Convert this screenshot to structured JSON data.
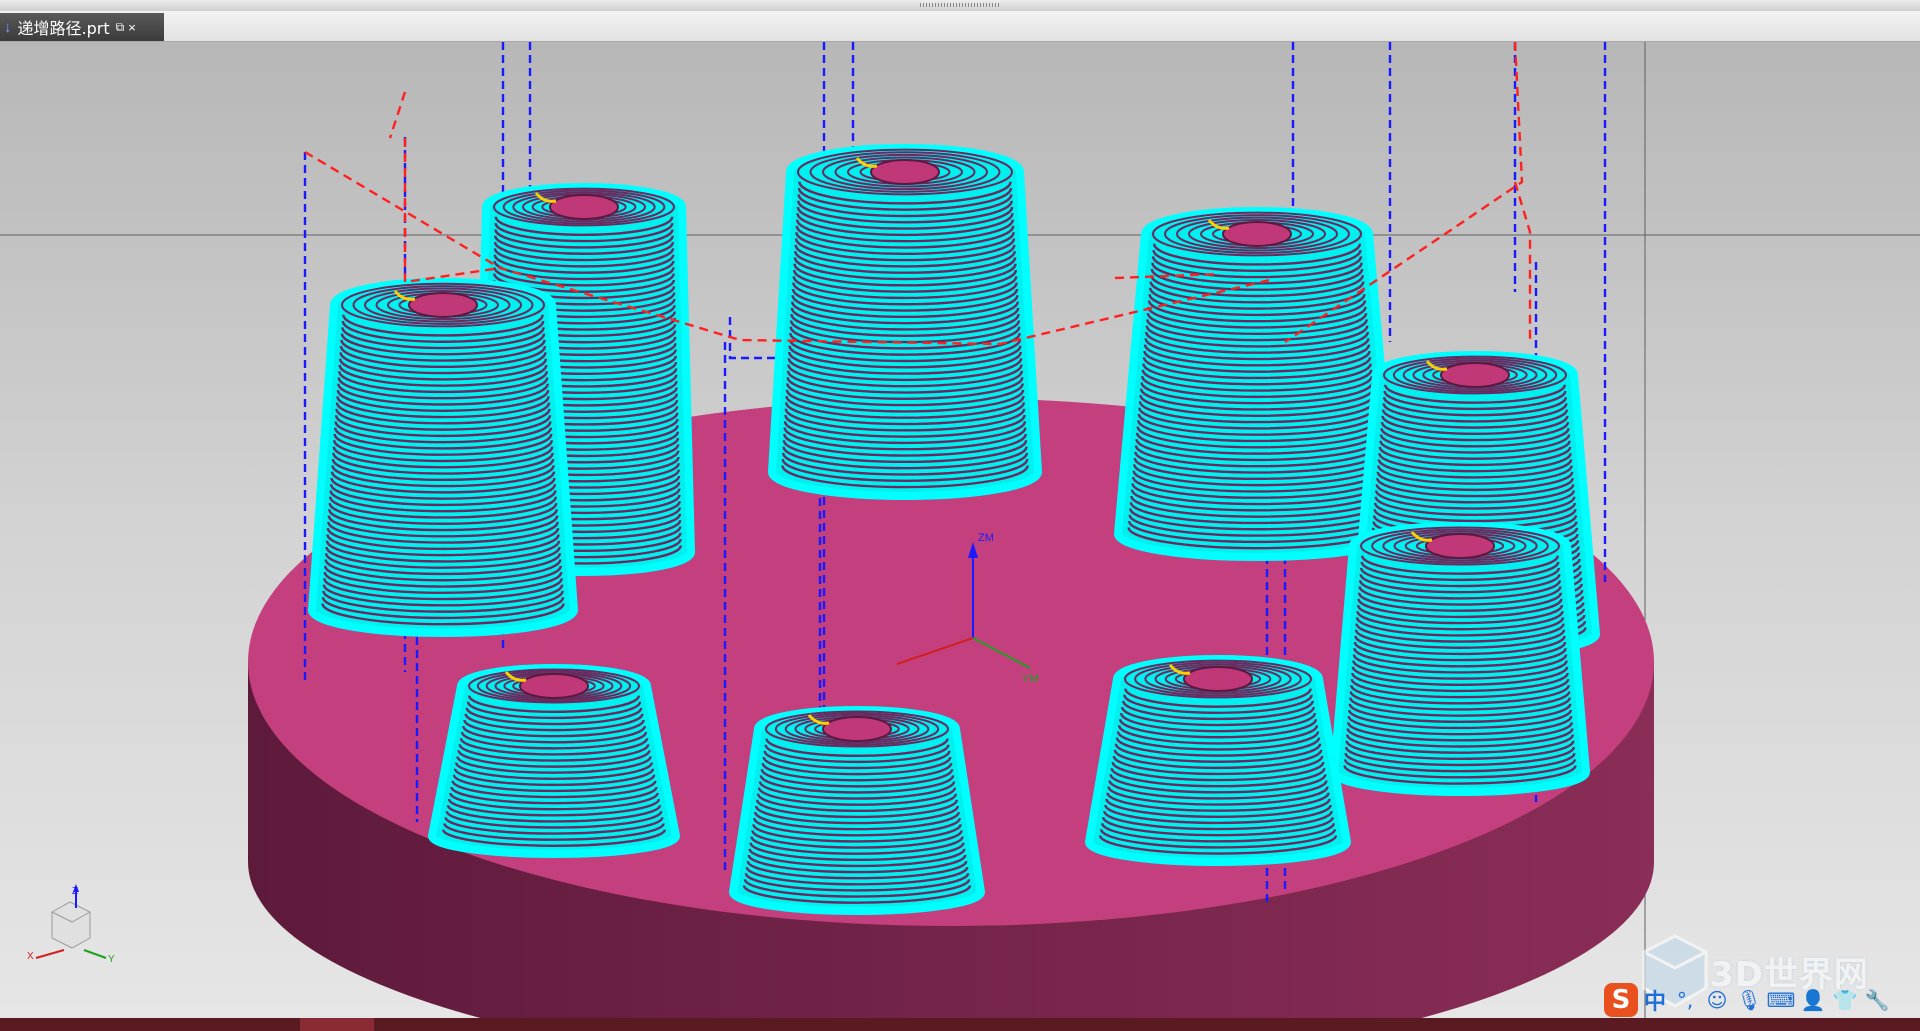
{
  "tab": {
    "file_name": "递增路径.prt",
    "restore_glyph": "⧉",
    "close_glyph": "×",
    "pin_glyph": "↓"
  },
  "viewport": {
    "background_top": "#bfbfbf",
    "background_bottom": "#e4e4e4",
    "base_color": "#c43f7d",
    "base_side_color": "#7a2450",
    "toolpath_color": "#00f0f0",
    "rapid_color": "#1a1aff",
    "engage_color": "#ff2020",
    "wcs_z_label": "ZM",
    "wcs_y_label": "YM",
    "triad_z": "Z",
    "triad_x": "X",
    "triad_y": "Y"
  },
  "ime": {
    "logo": "S",
    "lang": "中",
    "punct": "°,",
    "icons": [
      "smiley-icon",
      "microphone-icon",
      "keyboard-icon",
      "user-icon",
      "shirt-icon",
      "wrench-icon"
    ]
  },
  "watermark": {
    "text": "3D世界网"
  }
}
